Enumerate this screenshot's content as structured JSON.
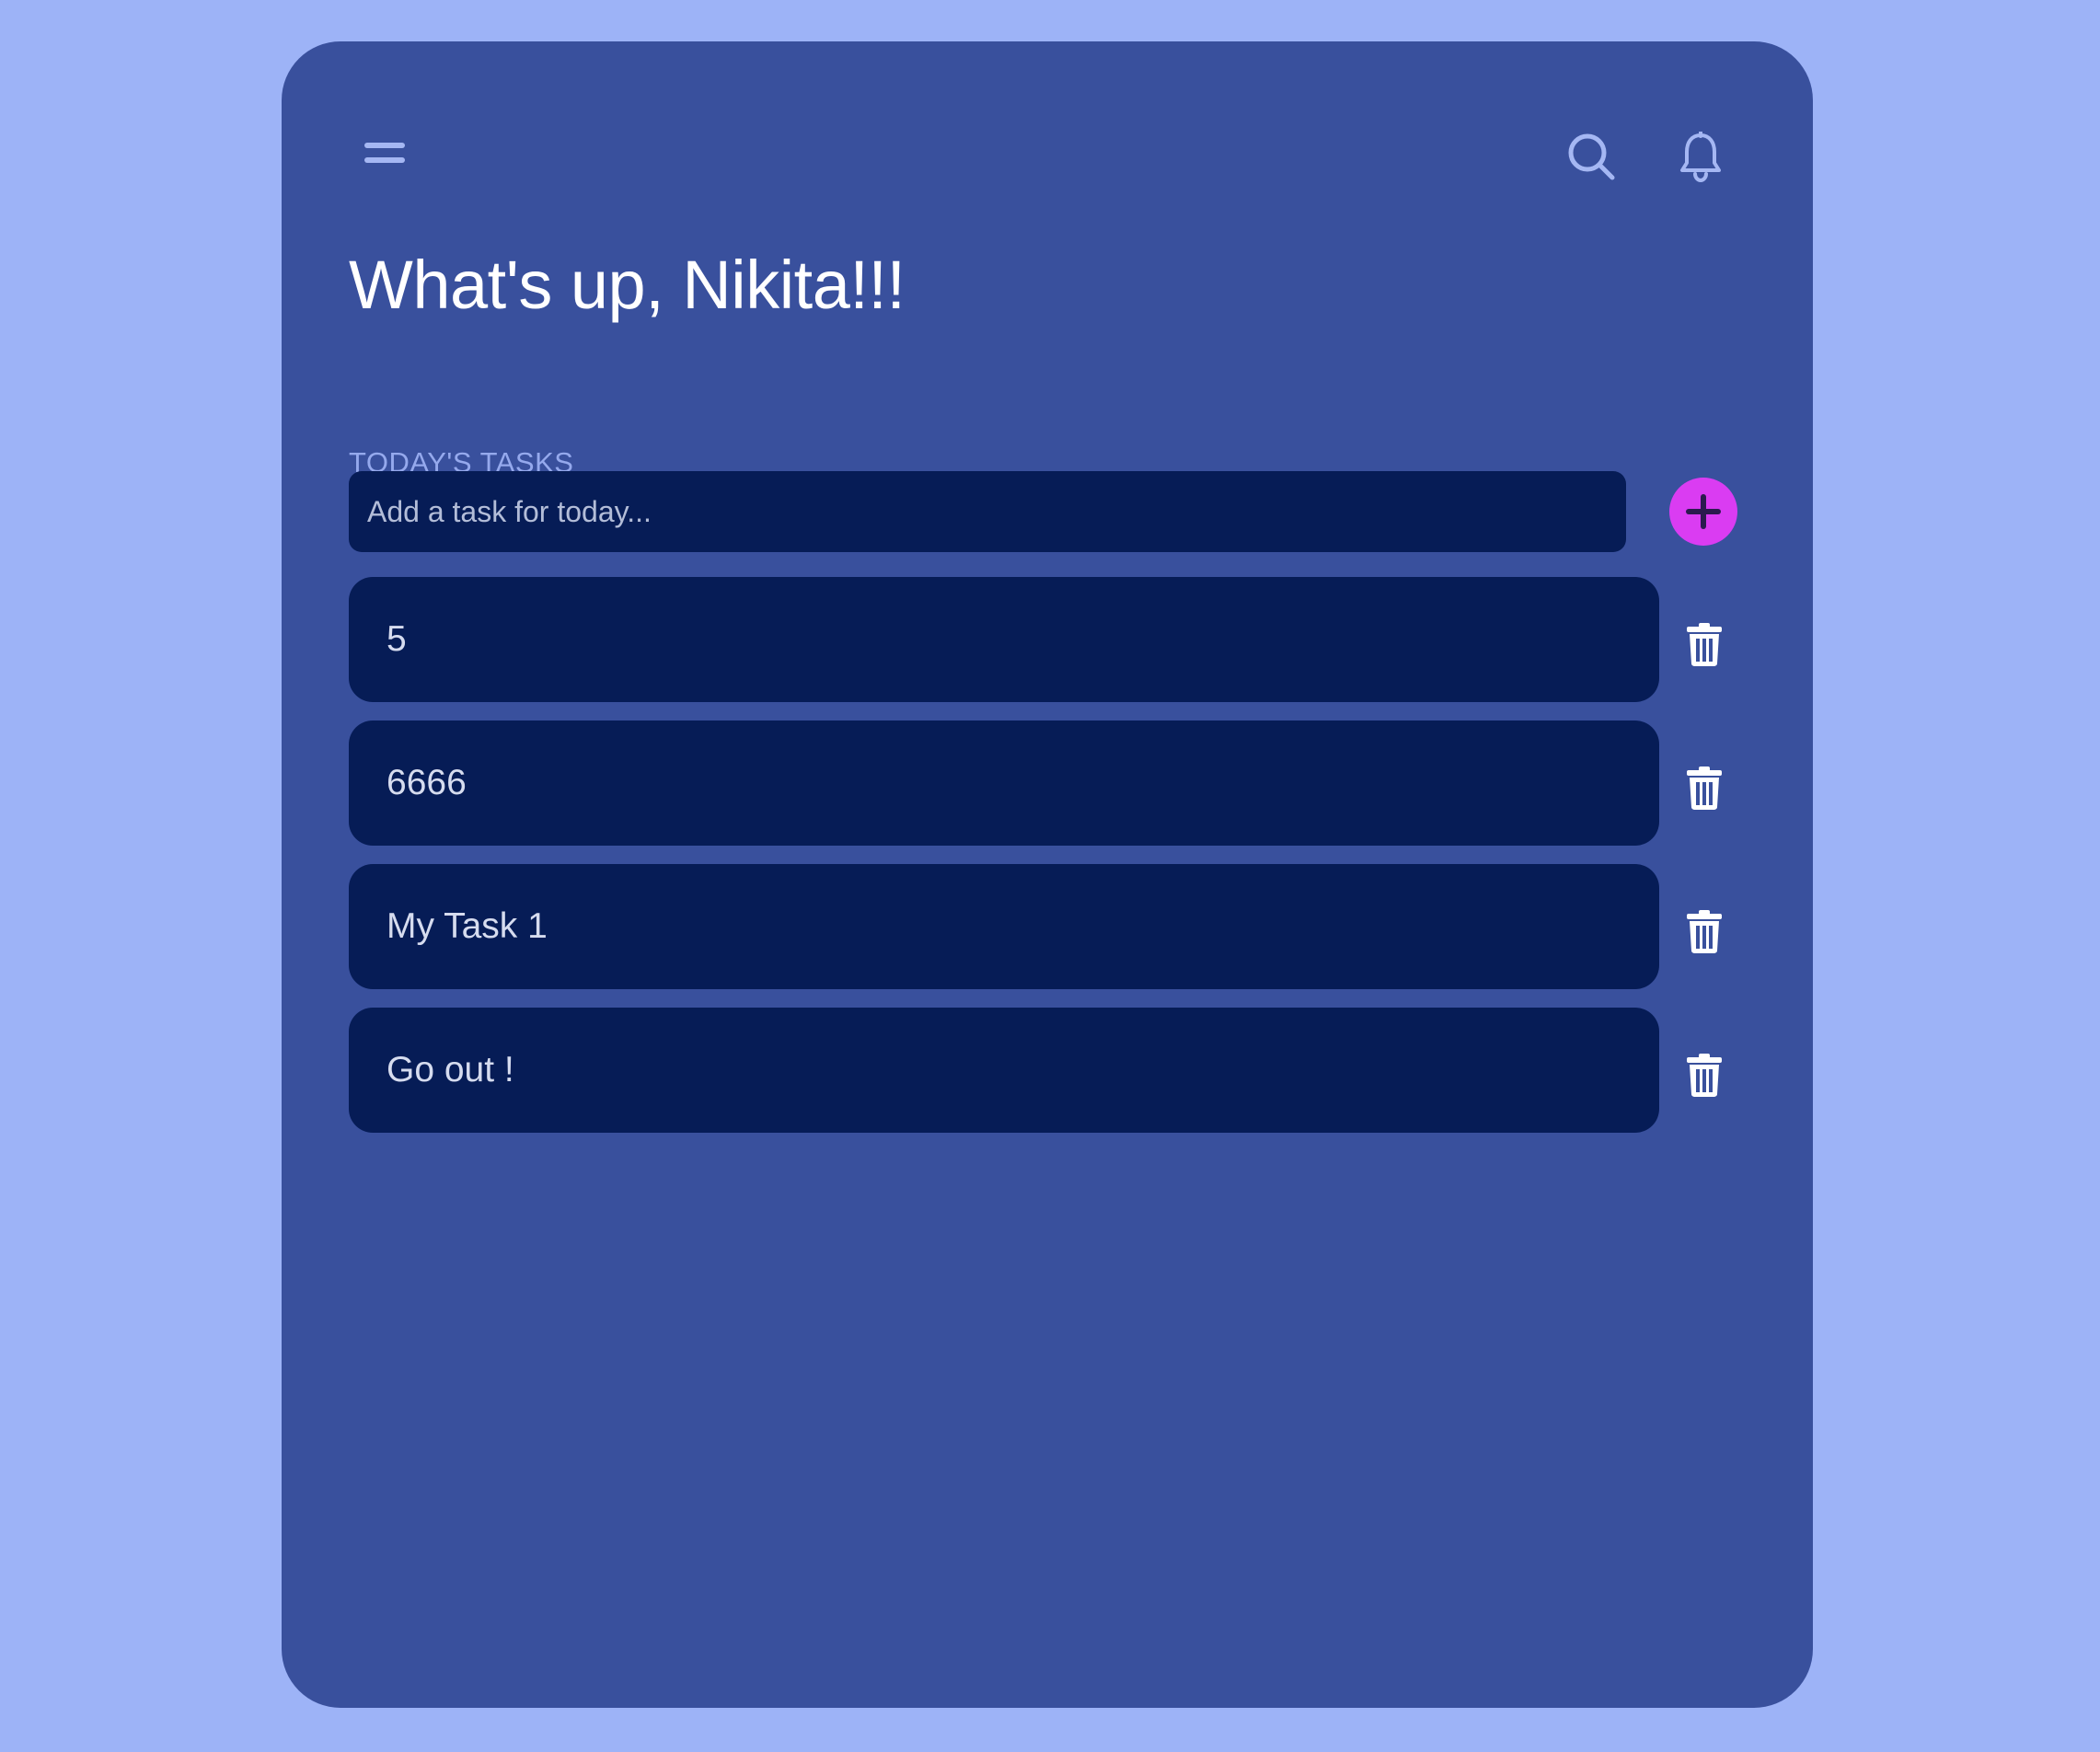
{
  "header": {
    "menu_icon": "hamburger-menu-icon",
    "search_icon": "search-icon",
    "notification_icon": "bell-icon"
  },
  "greeting": "What's up, Nikita!!!",
  "tasks_section": {
    "label": "TODAY'S TASKS",
    "input_placeholder": "Add a task for today...",
    "input_value": "",
    "add_icon": "plus-icon",
    "delete_icon": "trash-icon"
  },
  "tasks": [
    {
      "text": "5"
    },
    {
      "text": "6666"
    },
    {
      "text": "My Task 1"
    },
    {
      "text": "Go out !"
    }
  ],
  "colors": {
    "page_background": "#9db3f7",
    "panel_background": "#39509d",
    "card_background": "#061c56",
    "accent": "#da3cf2",
    "label": "#95a9ed"
  }
}
